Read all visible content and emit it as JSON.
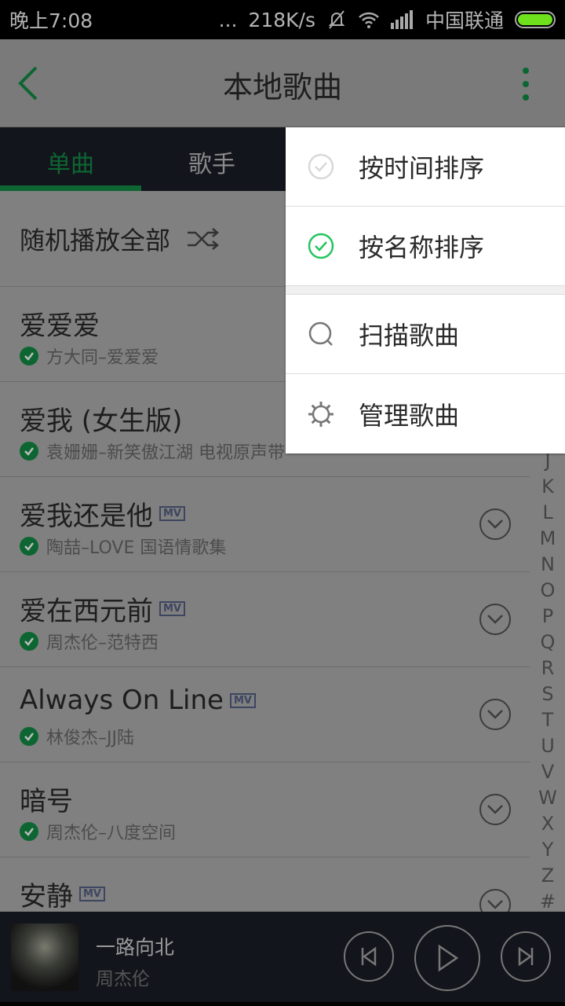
{
  "status": {
    "time": "晚上7:08",
    "dots": "...",
    "speed": "218K/s",
    "carrier": "中国联通",
    "battery_level": 1.0
  },
  "header": {
    "title": "本地歌曲"
  },
  "tabs": [
    {
      "label": "单曲",
      "active": true
    },
    {
      "label": "歌手",
      "active": false
    }
  ],
  "shuffle": {
    "label": "随机播放全部"
  },
  "songs": [
    {
      "title": "爱爱爱",
      "subtitle": "方大同–爱爱爱",
      "mv": false
    },
    {
      "title": "爱我 (女生版)",
      "subtitle": "袁姗姗–新笑傲江湖 电视原声带",
      "mv": false
    },
    {
      "title": "爱我还是他",
      "subtitle": "陶喆–LOVE 国语情歌集",
      "mv": true
    },
    {
      "title": "爱在西元前",
      "subtitle": "周杰伦–范特西",
      "mv": true
    },
    {
      "title": "Always On Line",
      "subtitle": "林俊杰–JJ陆",
      "mv": true
    },
    {
      "title": "暗号",
      "subtitle": "周杰伦–八度空间",
      "mv": false
    },
    {
      "title": "安静",
      "subtitle": "",
      "mv": true
    }
  ],
  "mv_badge": "MV",
  "index_letters": [
    "J",
    "K",
    "L",
    "M",
    "N",
    "O",
    "P",
    "Q",
    "R",
    "S",
    "T",
    "U",
    "V",
    "W",
    "X",
    "Y",
    "Z",
    "#"
  ],
  "menu": {
    "items": [
      {
        "label": "按时间排序",
        "icon": "check-circle-icon",
        "checked": false
      },
      {
        "label": "按名称排序",
        "icon": "check-circle-icon",
        "checked": true
      },
      {
        "label": "扫描歌曲",
        "icon": "search-icon"
      },
      {
        "label": "管理歌曲",
        "icon": "gear-icon"
      }
    ]
  },
  "player": {
    "title": "一路向北",
    "artist": "周杰伦"
  },
  "colors": {
    "accent": "#0d6632",
    "menu_check": "#22c55e"
  }
}
